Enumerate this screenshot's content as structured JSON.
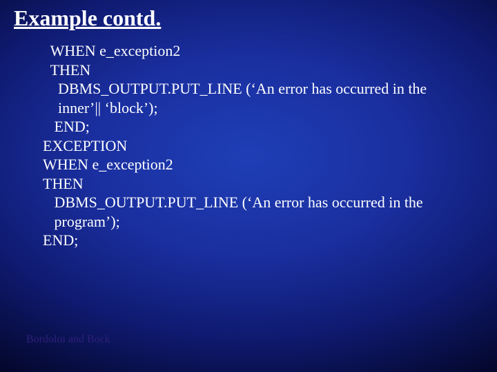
{
  "slide": {
    "title": "Example contd.",
    "code_lines": {
      "l0": "  WHEN e_exception2",
      "l1": "  THEN",
      "l2": "    DBMS_OUTPUT.PUT_LINE (‘An error has occurred in the",
      "l3": "    inner’|| ‘block’);",
      "l4": "   END;",
      "l5": "EXCEPTION",
      "l6": "WHEN e_exception2",
      "l7": "THEN",
      "l8": "   DBMS_OUTPUT.PUT_LINE (‘An error has occurred in the",
      "l9": "   program’);",
      "l10": "END;"
    },
    "footer": "Bordoloi and Bock"
  }
}
